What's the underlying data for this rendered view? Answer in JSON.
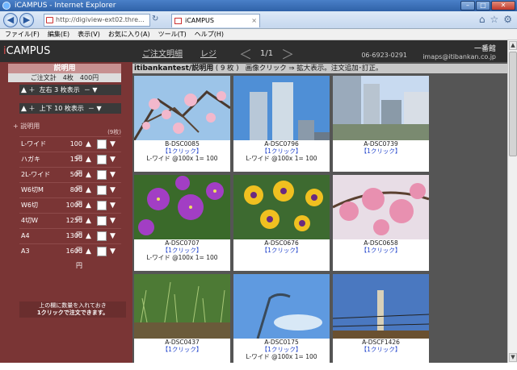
{
  "window": {
    "title": "iCAMPUS - Internet Explorer"
  },
  "browser": {
    "url": "http://digiview-ext02.thre...",
    "tab_title": "iCAMPUS"
  },
  "menu": [
    "ファイル(F)",
    "編集(E)",
    "表示(V)",
    "お気に入り(A)",
    "ツール(T)",
    "ヘルプ(H)"
  ],
  "header": {
    "brand_i": "i",
    "brand_rest": "CAMPUS",
    "nav_order": "ご注文明細",
    "nav_register": "レジ",
    "page_indicator": "1/1",
    "shop_name": "一番館",
    "phone": "06-6923-0291",
    "email": "imaps@itibankan.co.jp"
  },
  "sidebar": {
    "heading": "説明用",
    "cart_summary": "ご注文計　4枚　400円",
    "lr_label": "左右 3 枚表示",
    "ud_label": "上下 10 枚表示",
    "explain": "+ 説明用",
    "pieces": "(9枚)",
    "sizes": [
      {
        "name": "L-ワイド",
        "price": "100円"
      },
      {
        "name": "ハガキ",
        "price": "150円"
      },
      {
        "name": "2L-ワイド",
        "price": "500円"
      },
      {
        "name": "W6切M",
        "price": "800円"
      },
      {
        "name": "W6切",
        "price": "1000円"
      },
      {
        "name": "4切W",
        "price": "1250円"
      },
      {
        "name": "A4",
        "price": "1300円"
      },
      {
        "name": "A3",
        "price": "1600円"
      }
    ],
    "note_line1": "上の欄に数量を入れておき",
    "note_line2": "1クリックで注文できます。"
  },
  "content": {
    "album": "itibankantest/説明用",
    "count": "( 9 枚 )",
    "instruction": "画像クリック ⇒ 拡大表示。注文追加･訂正。"
  },
  "photos": [
    {
      "id": "B-DSC0085",
      "link": "【1クリック】",
      "order": "L-ワイド @100x 1= 100",
      "scene": "blossom-sky"
    },
    {
      "id": "A-DSC0796",
      "link": "【1クリック】",
      "order": "L-ワイド @100x 1= 100",
      "scene": "towers"
    },
    {
      "id": "A-DSC0739",
      "link": "【1クリック】",
      "order": "",
      "scene": "city"
    },
    {
      "id": "A-DSC0707",
      "link": "【1クリック】",
      "order": "L-ワイド @100x 1= 100",
      "scene": "purple-flowers"
    },
    {
      "id": "A-DSC0676",
      "link": "【1クリック】",
      "order": "",
      "scene": "pansies"
    },
    {
      "id": "A-DSC0658",
      "link": "【1クリック】",
      "order": "",
      "scene": "pink-blossom"
    },
    {
      "id": "A-DSC0437",
      "link": "【1クリック】",
      "order": "",
      "scene": "grass"
    },
    {
      "id": "A-DSC0175",
      "link": "【1クリック】",
      "order": "L-ワイド @100x 1= 100",
      "scene": "streetlamp"
    },
    {
      "id": "A-DSCF1426",
      "link": "【1クリック】",
      "order": "",
      "scene": "pole"
    }
  ]
}
